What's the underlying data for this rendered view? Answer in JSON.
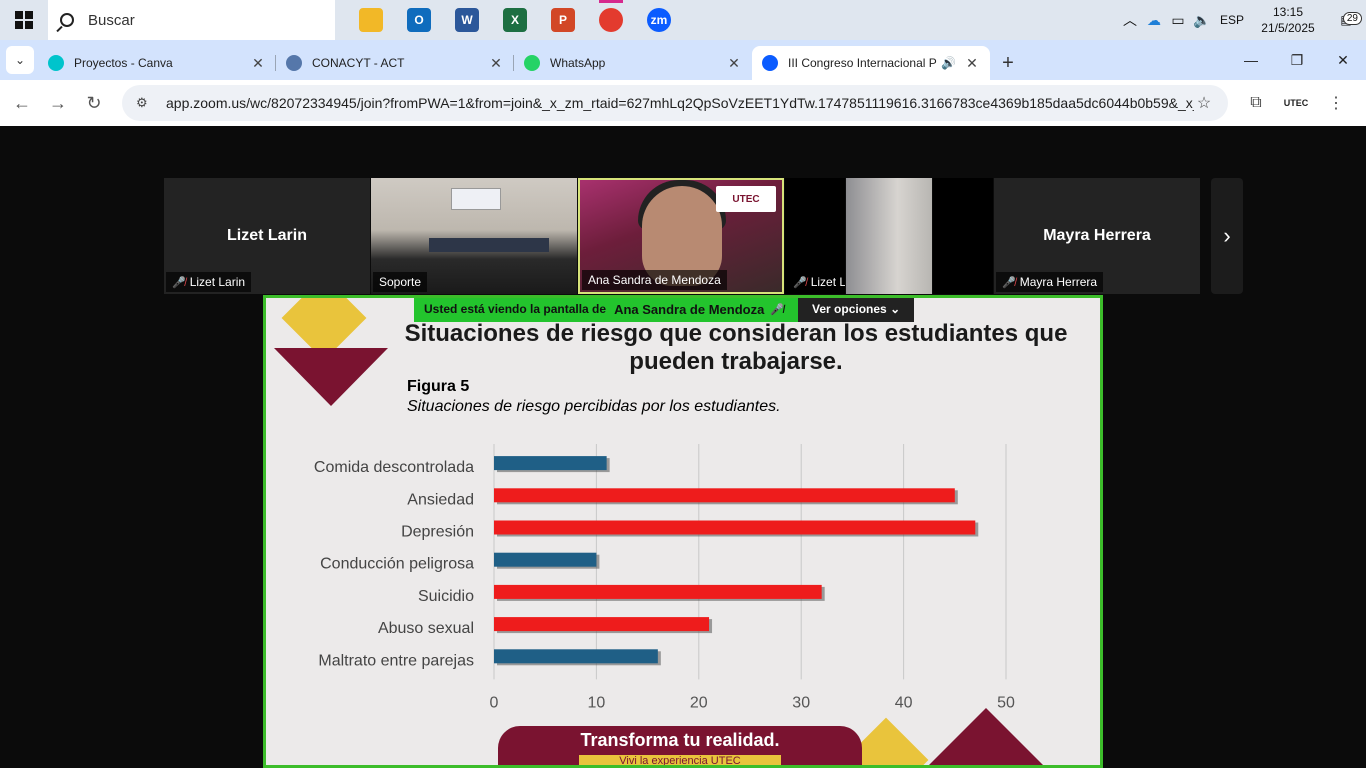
{
  "taskbar": {
    "search_placeholder": "Buscar",
    "apps": [
      {
        "name": "file-explorer",
        "label": "",
        "color": "#f2b827"
      },
      {
        "name": "outlook",
        "label": "O",
        "color": "#0f6cbd"
      },
      {
        "name": "word",
        "label": "W",
        "color": "#2b579a"
      },
      {
        "name": "excel",
        "label": "X",
        "color": "#1d6f42"
      },
      {
        "name": "powerpoint",
        "label": "P",
        "color": "#d24726"
      },
      {
        "name": "chrome",
        "label": "",
        "color": "#e33b2e"
      },
      {
        "name": "zoom",
        "label": "zm",
        "color": "#0b5cff"
      }
    ],
    "language": "ESP",
    "time": "13:15",
    "date": "21/5/2025",
    "notifications": "29"
  },
  "tabs": [
    {
      "label": "Proyectos - Canva",
      "icon_color": "#00c4cc"
    },
    {
      "label": "CONACYT - ACT",
      "icon_color": "#5577aa"
    },
    {
      "label": "WhatsApp",
      "icon_color": "#25d366"
    },
    {
      "label": "III Congreso Internacional P",
      "icon_color": "#0b5cff",
      "active": true
    }
  ],
  "address": {
    "url": "app.zoom.us/wc/82072334945/join?fromPWA=1&from=join&_x_zm_rtaid=627mhLq2QpSoVzEET1YdTw.1747851119616.3166783ce4369b185daa5dc6044b0b59&_x_..."
  },
  "participants": [
    {
      "display": "Lizet Larin",
      "label": "Lizet Larin",
      "muted": true
    },
    {
      "display": "",
      "label": "Soporte",
      "muted": false
    },
    {
      "display": "",
      "label": "Ana Sandra de Mendoza",
      "muted": false,
      "speaker_logo": "UTEC"
    },
    {
      "display": "",
      "label": "Lizet Larín",
      "muted": true
    },
    {
      "display": "Mayra Herrera",
      "label": "Mayra Herrera",
      "muted": true
    }
  ],
  "share_banner": {
    "text": "Usted está viendo la pantalla de",
    "presenter": "Ana Sandra de Mendoza",
    "options": "Ver opciones"
  },
  "slide": {
    "title": "Situaciones de riesgo que consideran los estudiantes que pueden trabajarse.",
    "figure_label": "Figura 5",
    "figure_caption": "Situaciones de riesgo percibidas por los estudiantes.",
    "footer_title": "Transforma tu realidad.",
    "footer_sub": "Vivi la experiencia UTEC"
  },
  "chart_data": {
    "type": "bar",
    "orientation": "horizontal",
    "categories": [
      "Comida descontrolada",
      "Ansiedad",
      "Depresión",
      "Conducción peligrosa",
      "Suicidio",
      "Abuso sexual",
      "Maltrato entre parejas"
    ],
    "values": [
      11,
      45,
      47,
      10,
      32,
      21,
      16
    ],
    "colors": [
      "#1f5f86",
      "#ee1c1c",
      "#ee1c1c",
      "#1f5f86",
      "#ee1c1c",
      "#ee1c1c",
      "#1f5f86"
    ],
    "xlim": [
      0,
      50
    ],
    "xticks": [
      0,
      10,
      20,
      30,
      40,
      50
    ],
    "grid": true
  }
}
